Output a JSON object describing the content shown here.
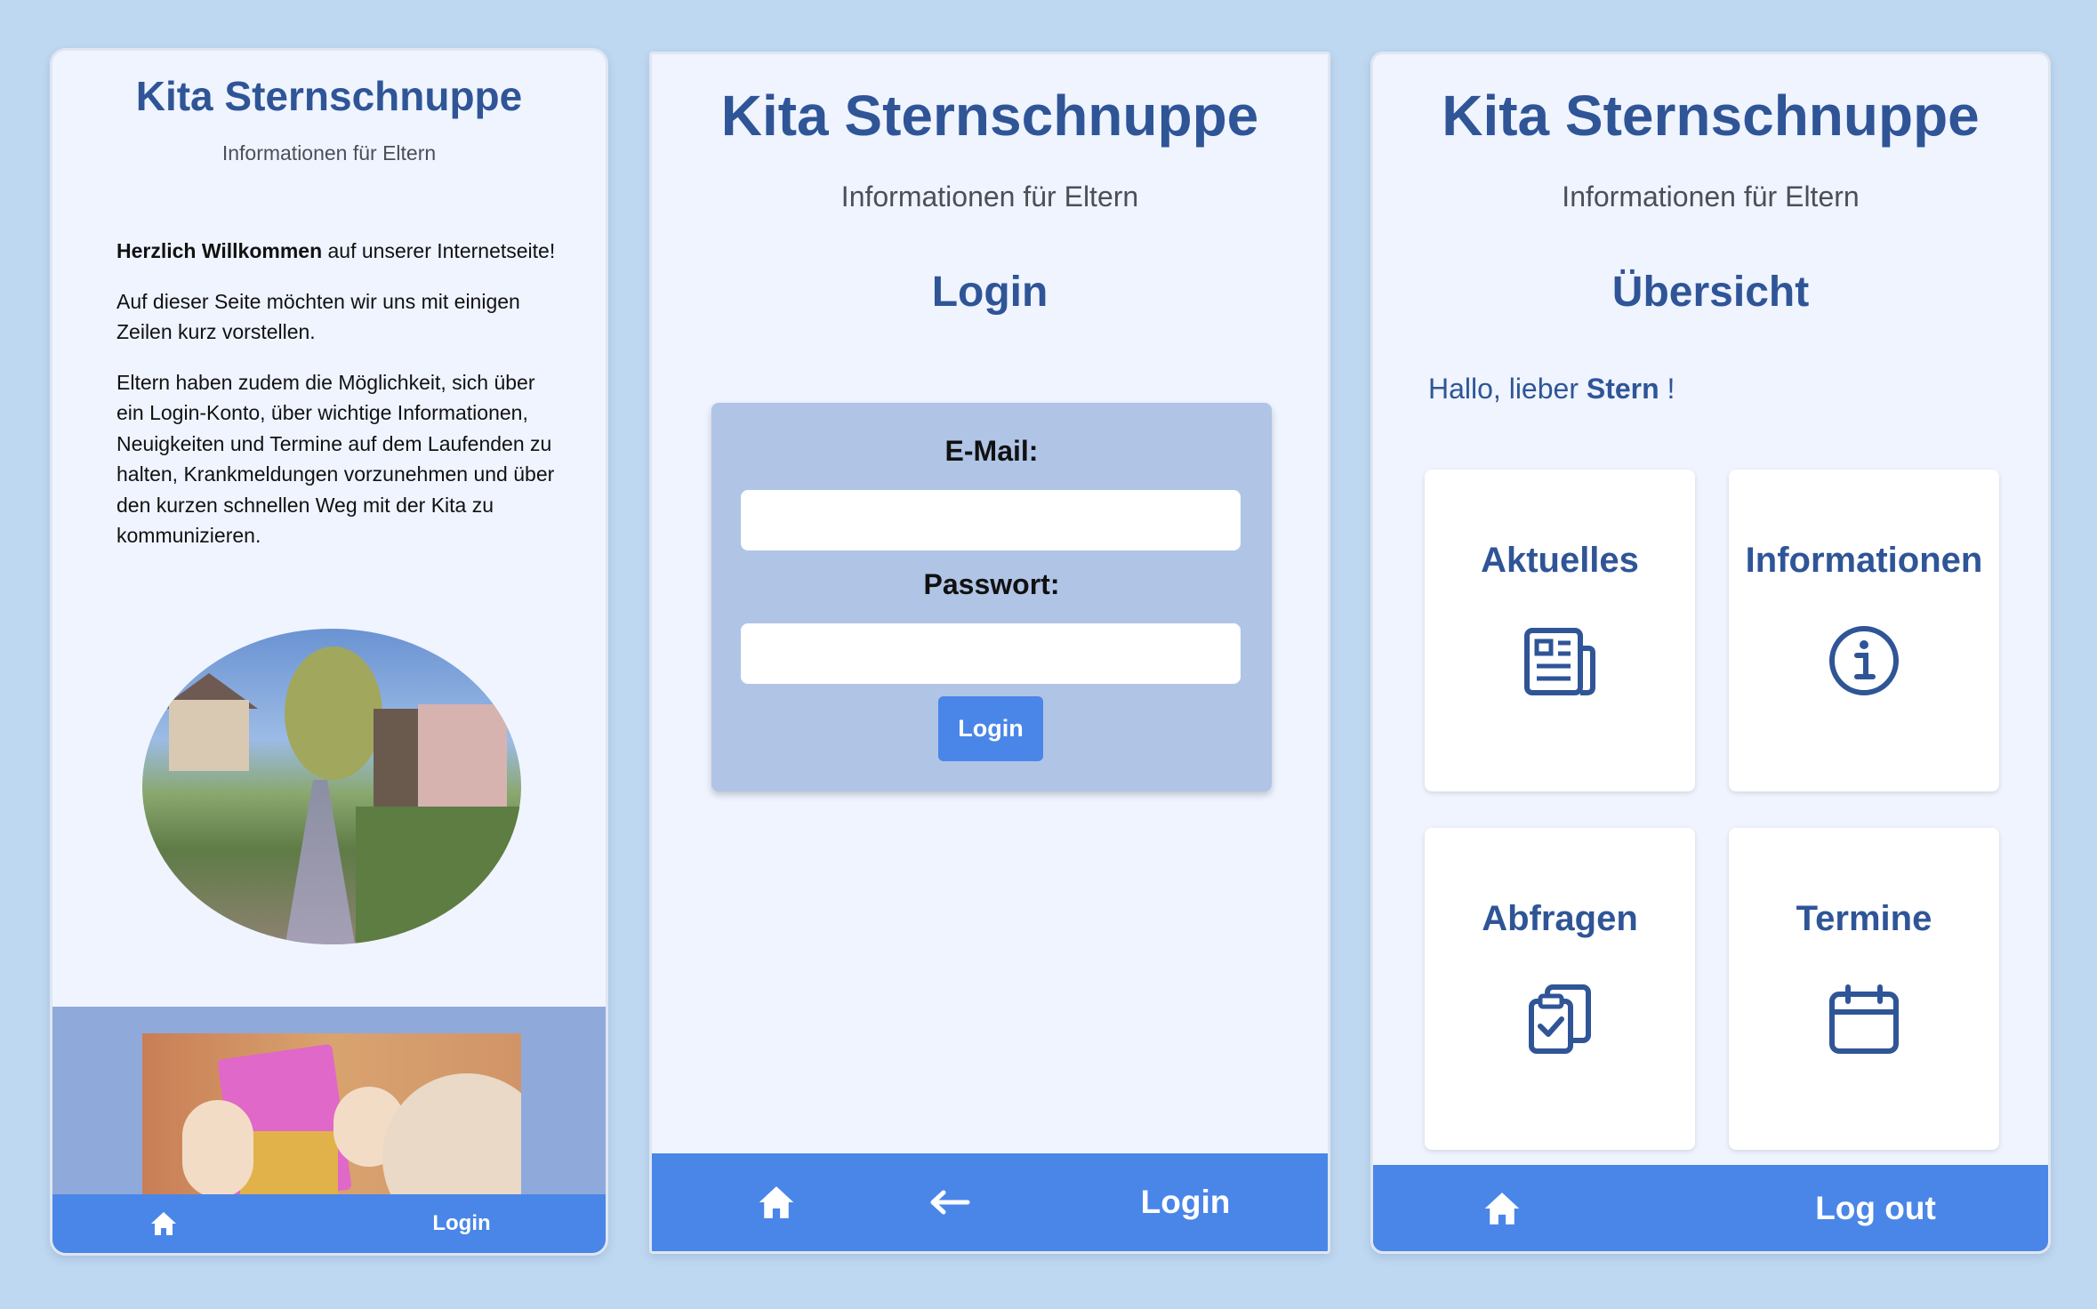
{
  "colors": {
    "background": "#bfd8f1",
    "screen": "#eff4ff",
    "primary_text": "#2f5597",
    "nav_bar": "#4a86e8",
    "login_card": "#b0c4e6",
    "band": "#8fa9db"
  },
  "app": {
    "title": "Kita Sternschnuppe",
    "subtitle": "Informationen für Eltern"
  },
  "welcome_screen": {
    "intro_bold": "Herzlich Willkommen",
    "intro_rest": " auf unserer Internetseite!",
    "paragraph2": "Auf dieser Seite möchten wir uns mit einigen Zeilen kurz vorstellen.",
    "paragraph3": "Eltern haben zudem die Möglichkeit, sich über ein Login-Konto, über wichtige Informationen, Neuigkeiten und Termine auf dem Laufenden zu halten, Krankmeldungen vorzunehmen und über den kurzen schnellen Weg mit der Kita zu kommunizieren.",
    "nav": {
      "home_icon": "home-icon",
      "login_label": "Login"
    }
  },
  "login_screen": {
    "heading": "Login",
    "email_label": "E-Mail:",
    "email_value": "",
    "password_label": "Passwort:",
    "password_value": "",
    "submit_label": "Login",
    "nav": {
      "home_icon": "home-icon",
      "back_icon": "arrow-left-icon",
      "login_label": "Login"
    }
  },
  "overview_screen": {
    "heading": "Übersicht",
    "greeting_prefix": "Hallo, lieber ",
    "greeting_name": "Stern",
    "greeting_suffix": " !",
    "cards": [
      {
        "label": "Aktuelles",
        "icon": "newspaper-icon"
      },
      {
        "label": "Informationen",
        "icon": "info-icon"
      },
      {
        "label": "Abfragen",
        "icon": "clipboard-check-icon"
      },
      {
        "label": "Termine",
        "icon": "calendar-icon"
      }
    ],
    "nav": {
      "home_icon": "home-icon",
      "logout_label": "Log out"
    }
  }
}
